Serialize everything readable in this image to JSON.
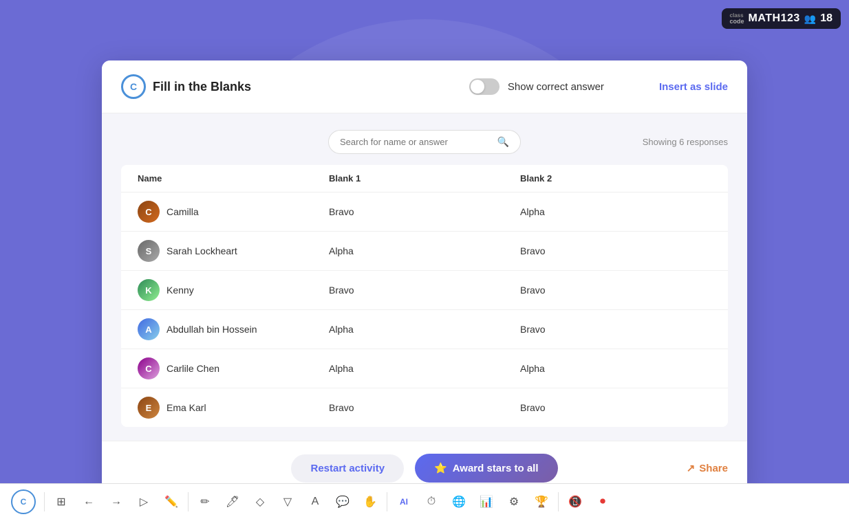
{
  "badge": {
    "class_label": "class",
    "code_label": "code",
    "class_code": "MATH123",
    "user_count": "18"
  },
  "modal": {
    "title": "Fill in the Blanks",
    "toggle_label": "Show correct answer",
    "insert_slide": "Insert as slide",
    "search_placeholder": "Search for name or answer",
    "showing_text": "Showing 6 responses",
    "columns": {
      "name": "Name",
      "blank1": "Blank 1",
      "blank2": "Blank 2"
    },
    "students": [
      {
        "name": "Camilla",
        "blank1": "Bravo",
        "blank2": "Alpha",
        "avatar": "C"
      },
      {
        "name": "Sarah Lockheart",
        "blank1": "Alpha",
        "blank2": "Bravo",
        "avatar": "S"
      },
      {
        "name": "Kenny",
        "blank1": "Bravo",
        "blank2": "Bravo",
        "avatar": "K"
      },
      {
        "name": "Abdullah bin Hossein",
        "blank1": "Alpha",
        "blank2": "Bravo",
        "avatar": "A"
      },
      {
        "name": "Carlile Chen",
        "blank1": "Alpha",
        "blank2": "Alpha",
        "avatar": "C"
      },
      {
        "name": "Ema Karl",
        "blank1": "Bravo",
        "blank2": "Bravo",
        "avatar": "E"
      }
    ],
    "footer": {
      "restart_label": "Restart activity",
      "award_label": "Award stars to all",
      "share_label": "Share"
    }
  },
  "toolbar": {
    "logo": "C"
  }
}
